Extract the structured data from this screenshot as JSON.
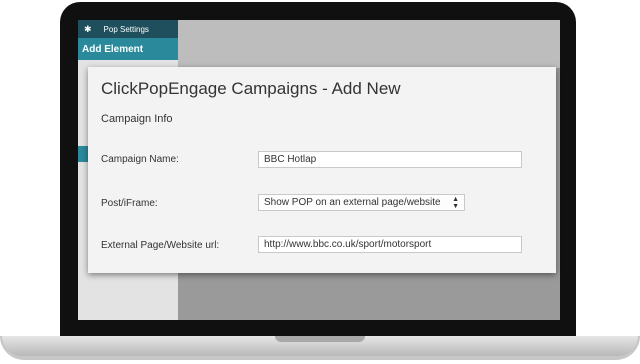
{
  "sidebar": {
    "header_label": "Pop Settings",
    "add_element_label": "Add Element"
  },
  "panel": {
    "title": "ClickPopEngage Campaigns - Add New",
    "section_title": "Campaign Info",
    "fields": {
      "campaign_name": {
        "label": "Campaign Name:",
        "value": "BBC Hotlap"
      },
      "post_iframe": {
        "label": "Post/iFrame:",
        "selected": "Show POP on an external page/website"
      },
      "external_url": {
        "label": "External Page/Website url:",
        "value": "http://www.bbc.co.uk/sport/motorsport"
      }
    }
  },
  "icons": {
    "gear": "gear-icon",
    "select_arrow": "up-down-arrow-icon"
  }
}
